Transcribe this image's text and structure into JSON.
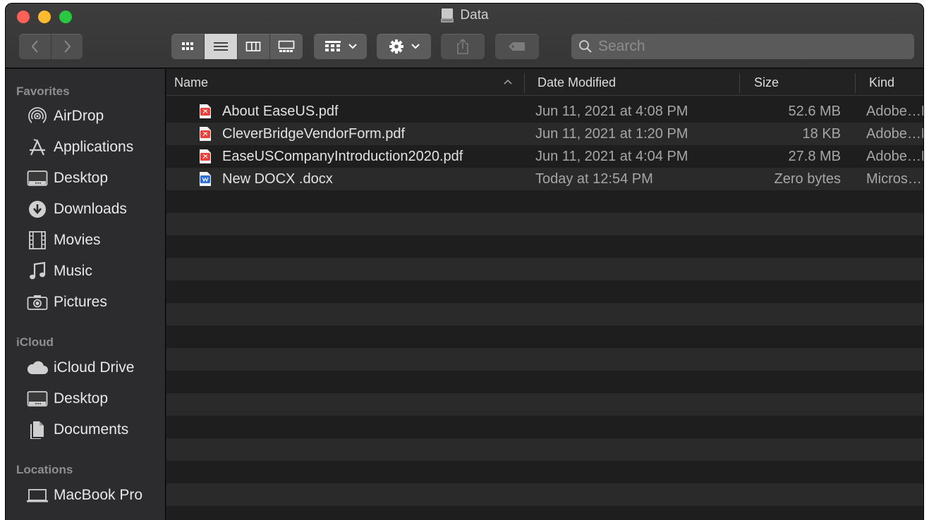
{
  "window": {
    "title": "Data",
    "title_icon": "disk-icon"
  },
  "toolbar": {
    "back_icon": "chevron-left-icon",
    "forward_icon": "chevron-right-icon",
    "view_modes": [
      "icon-view",
      "list-view",
      "column-view",
      "gallery-view"
    ],
    "active_view": "list-view",
    "group_icon": "group-by-icon",
    "action_icon": "gear-icon",
    "share_icon": "share-icon",
    "tag_icon": "tag-icon"
  },
  "search": {
    "placeholder": "Search",
    "value": ""
  },
  "sidebar": {
    "sections": [
      {
        "title": "Favorites",
        "items": [
          {
            "label": "AirDrop",
            "icon": "airdrop-icon"
          },
          {
            "label": "Applications",
            "icon": "applications-icon"
          },
          {
            "label": "Desktop",
            "icon": "desktop-icon"
          },
          {
            "label": "Downloads",
            "icon": "downloads-icon"
          },
          {
            "label": "Movies",
            "icon": "movies-icon"
          },
          {
            "label": "Music",
            "icon": "music-icon"
          },
          {
            "label": "Pictures",
            "icon": "pictures-icon"
          }
        ]
      },
      {
        "title": "iCloud",
        "items": [
          {
            "label": "iCloud Drive",
            "icon": "cloud-icon"
          },
          {
            "label": "Desktop",
            "icon": "desktop-icon"
          },
          {
            "label": "Documents",
            "icon": "documents-icon"
          }
        ]
      },
      {
        "title": "Locations",
        "items": [
          {
            "label": "MacBook Pro",
            "icon": "laptop-icon"
          }
        ]
      }
    ]
  },
  "columns": {
    "name": "Name",
    "date": "Date Modified",
    "size": "Size",
    "kind": "Kind"
  },
  "files": [
    {
      "name": "About EaseUS.pdf",
      "date": "Jun 11, 2021 at 4:08 PM",
      "size": "52.6 MB",
      "kind": "Adobe…F",
      "icon": "pdf-file-icon"
    },
    {
      "name": "CleverBridgeVendorForm.pdf",
      "date": "Jun 11, 2021 at 1:20 PM",
      "size": "18 KB",
      "kind": "Adobe…F",
      "icon": "pdf-file-icon"
    },
    {
      "name": "EaseUSCompanyIntroduction2020.pdf",
      "date": "Jun 11, 2021 at 4:04 PM",
      "size": "27.8 MB",
      "kind": "Adobe…F",
      "icon": "pdf-file-icon"
    },
    {
      "name": "New DOCX .docx",
      "date": "Today at 12:54 PM",
      "size": "Zero bytes",
      "kind": "Micros…",
      "icon": "docx-file-icon"
    }
  ],
  "colors": {
    "pdf": "#e8423a",
    "docx": "#2b6fd6",
    "red": "#fe5f57",
    "yellow": "#febb2e",
    "green": "#28c840"
  }
}
